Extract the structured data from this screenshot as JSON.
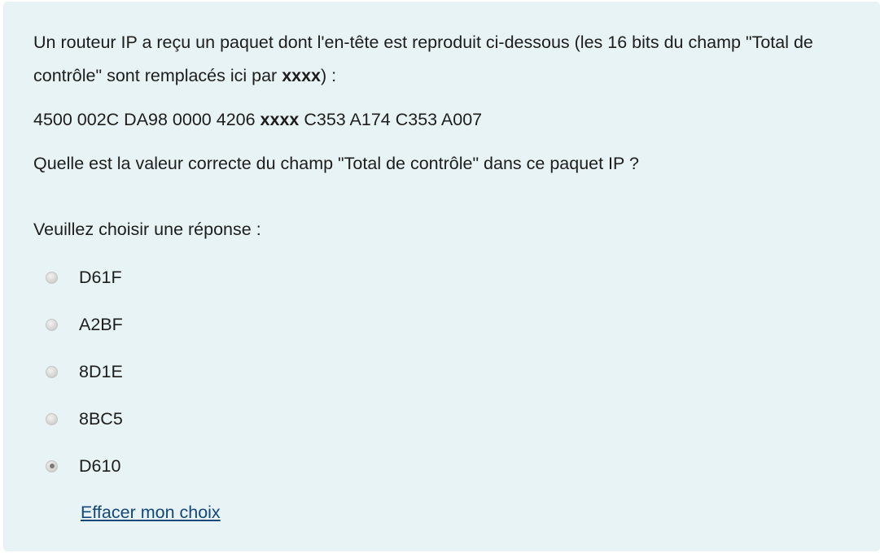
{
  "question": {
    "line1_part1": " Un routeur IP a reçu un paquet dont l'en-tête est reproduit ci-dessous (les 16 bits du champ \"Total de contrôle\" sont remplacés   ici par ",
    "line1_bold": "xxxx",
    "line1_part2": ") :",
    "header_part1": "4500 002C DA98 0000 4206 ",
    "header_bold": "xxxx",
    "header_part2": " C353 A174 C353 A007",
    "question_text": "Quelle est la valeur correcte du champ \"Total de contrôle\" dans ce paquet IP ?"
  },
  "answer_prompt": "Veuillez choisir une réponse :",
  "answers": [
    {
      "label": "D61F",
      "selected": false
    },
    {
      "label": "A2BF",
      "selected": false
    },
    {
      "label": "8D1E",
      "selected": false
    },
    {
      "label": "8BC5",
      "selected": false
    },
    {
      "label": "D610",
      "selected": true
    }
  ],
  "clear_choice_label": "Effacer mon choix",
  "colors": {
    "panel_background": "#e7f3f5",
    "link": "#14477a",
    "text": "#1d1d1b"
  }
}
